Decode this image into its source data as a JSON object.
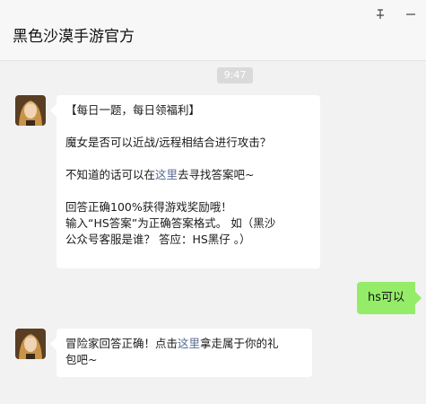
{
  "header": {
    "title": "黑色沙漠手游官方",
    "pin_glyph": "⊥",
    "minimize_glyph": "—"
  },
  "timestamp": "9:47",
  "messages": {
    "first": {
      "line1": "【每日一题，每日领福利】",
      "line2": "魔女是否可以近战/远程相结合进行攻击？",
      "line3_prefix": "不知道的话可以在",
      "line3_link": "这里",
      "line3_suffix": "去寻找答案吧~",
      "line4": "回答正确100%获得游戏奖励哦！",
      "line5": "输入“HS答案”为正确答案格式。 如（黑沙",
      "line6": "公众号客服是谁？ 答应：HS黑仔 。）"
    },
    "mine": "hs可以",
    "second": {
      "line1_prefix": "冒险家回答正确！点击",
      "line1_link": "这里",
      "line1_suffix": "拿走属于你的礼",
      "line2": "包吧~"
    }
  },
  "colors": {
    "link": "#576b95",
    "my_bubble": "#95ec69",
    "background": "#f2f2f2"
  }
}
